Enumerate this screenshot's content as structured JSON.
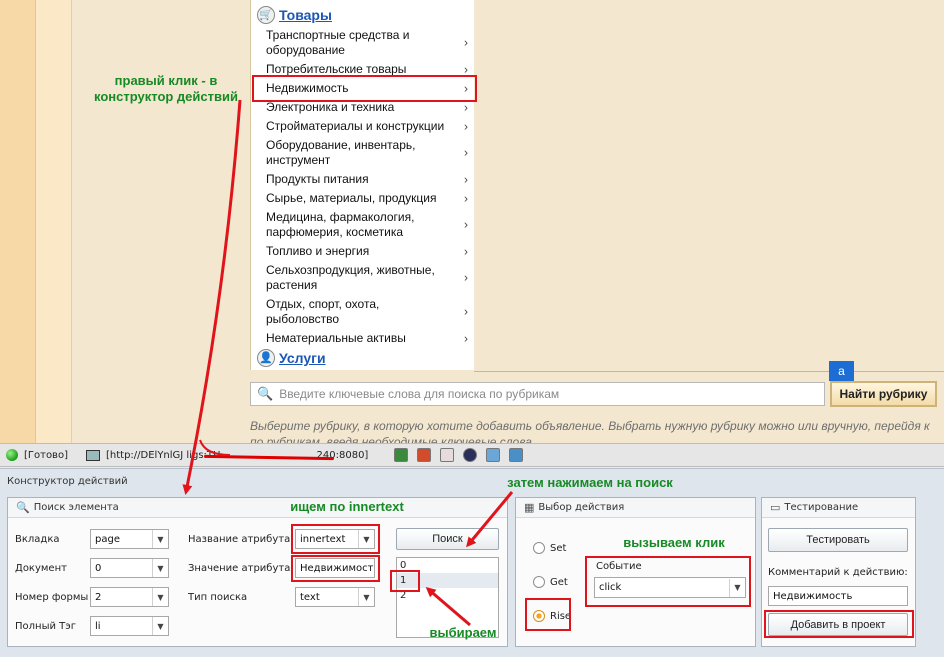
{
  "rubrics": {
    "goods_title": "Товары",
    "services_title": "Услуги",
    "items": [
      {
        "label": "Транспортные средства и оборудование"
      },
      {
        "label": "Потребительские товары"
      },
      {
        "label": "Недвижимость"
      },
      {
        "label": "Электроника и техника"
      },
      {
        "label": "Стройматериалы и конструкции"
      },
      {
        "label": "Оборудование, инвентарь, инструмент"
      },
      {
        "label": "Продукты питания"
      },
      {
        "label": "Сырье, материалы, продукция"
      },
      {
        "label": "Медицина, фармакология, парфюмерия, косметика"
      },
      {
        "label": "Топливо и энергия"
      },
      {
        "label": "Сельхозпродукция, животные, растения"
      },
      {
        "label": "Отдых, спорт, охота, рыболовство"
      },
      {
        "label": "Нематериальные активы"
      }
    ],
    "chevron": "›",
    "search_placeholder": "Введите ключевые слова для поиска по рубрикам",
    "a_badge": "a",
    "find_button": "Найти рубрику",
    "hint": "Выберите рубрику, в которую хотите добавить объявление. Выбрать нужную рубрику можно или вручную, перейдя к",
    "hint2": "по рубрикам, введя необходимые ключевые слова"
  },
  "statusbar": {
    "status": "[Готово]",
    "url_left": "[http://DElYnlGJ ligs:TH",
    "url_right": "240:8080]"
  },
  "constructor": {
    "title": "Конструктор действий",
    "search_group": {
      "title": "Поиск элемента",
      "tab_label": "Вкладка",
      "tab_value": "page",
      "doc_label": "Документ",
      "doc_value": "0",
      "form_label": "Номер формы",
      "form_value": "2",
      "tag_label": "Полный Тэг",
      "tag_value": "li",
      "attr_name_label": "Название атрибута",
      "attr_name_value": "innertext",
      "attr_value_label": "Значение атрибута",
      "attr_value_value": "Недвижимость",
      "search_type_label": "Тип поиска",
      "search_type_value": "text",
      "search_button": "Поиск",
      "results": [
        "0",
        "1",
        "2"
      ]
    },
    "action_group": {
      "title": "Выбор действия",
      "set_label": "Set",
      "get_label": "Get",
      "rise_label": "Rise",
      "event_label": "Событие",
      "event_value": "click"
    },
    "test_group": {
      "title": "Тестирование",
      "test_button": "Тестировать",
      "comment_label": "Комментарий к действию:",
      "comment_value": "Недвижимость",
      "add_button": "Добавить в проект"
    }
  },
  "annotations": {
    "right_click": "правый клик - в конструктор действий",
    "search_innertext": "ищем по innertext",
    "then_search": "затем нажимаем на поиск",
    "call_click": "вызываем клик",
    "choose": "выбираем"
  },
  "colors": {
    "annotation_red": "#e0141b",
    "annotation_green": "#178a26",
    "link_blue": "#1c57b6"
  }
}
